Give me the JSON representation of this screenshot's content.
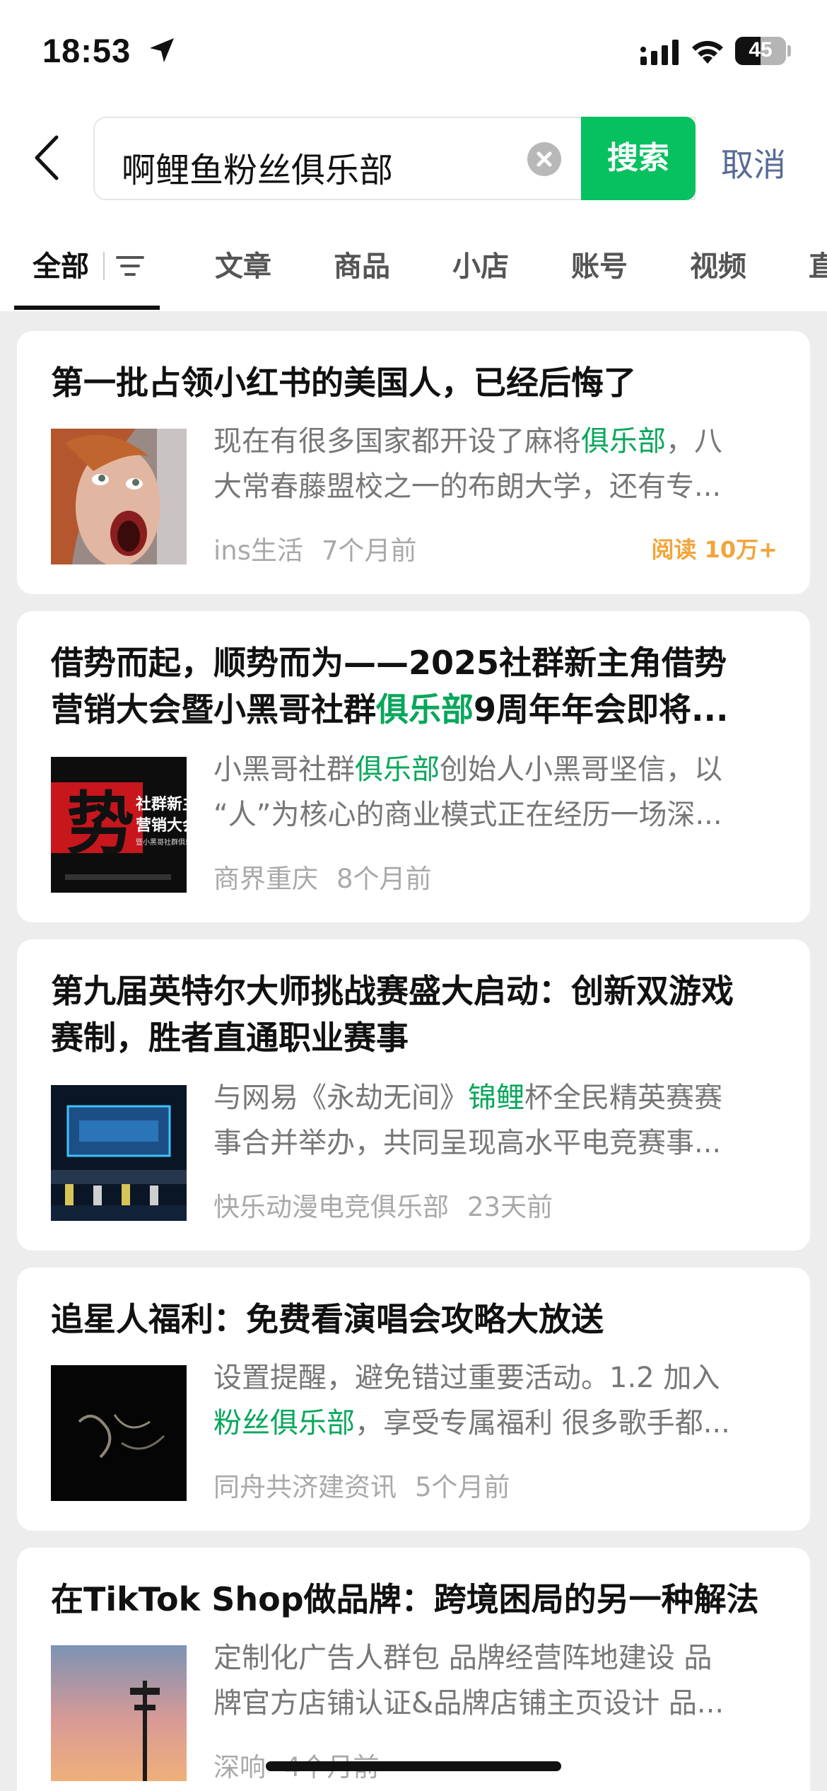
{
  "status_bar": {
    "time": "18:53",
    "battery": "45"
  },
  "search": {
    "query": "啊鲤鱼粉丝俱乐部",
    "button_label": "搜索",
    "cancel_label": "取消"
  },
  "tabs": [
    {
      "label": "全部",
      "active": true
    },
    {
      "label": "文章"
    },
    {
      "label": "商品"
    },
    {
      "label": "小店"
    },
    {
      "label": "账号"
    },
    {
      "label": "视频"
    },
    {
      "label": "直"
    }
  ],
  "results": [
    {
      "title": "第一批占领小红书的美国人，已经后悔了",
      "snippet_line1": [
        "现在有很多国家都开设了麻将",
        "俱乐部",
        "，八"
      ],
      "snippet_line2": "大常春藤盟校之一的布朗大学，还有专...",
      "source": "ins生活",
      "time": "7个月前",
      "reads": "阅读 10万+"
    },
    {
      "title_line1": "借势而起，顺势而为——2025社群新主角借势",
      "title_line2": [
        "营销大会暨小黑哥社群",
        "俱乐部",
        "9周年年会即将..."
      ],
      "snippet_line1": [
        "小黑哥社群",
        "俱乐部",
        "创始人小黑哥坚信，以"
      ],
      "snippet_line2": "“人”为核心的商业模式正在经历一场深...",
      "source": "商界重庆",
      "time": "8个月前",
      "thumb_text": [
        "势",
        "社群新主",
        "营销大会",
        "暨小黑哥社群俱乐"
      ]
    },
    {
      "title_line1": "第九届英特尔大师挑战赛盛大启动：创新双游戏",
      "title_line2": "赛制，胜者直通职业赛事",
      "snippet_line1": [
        "与网易《永劫无间》",
        "锦鲤",
        "杯全民精英赛赛"
      ],
      "snippet_line2": "事合并举办，共同呈现高水平电竞赛事...",
      "source": "快乐动漫电竞俱乐部",
      "time": "23天前"
    },
    {
      "title": "追星人福利：免费看演唱会攻略大放送",
      "snippet_line1": "设置提醒，避免错过重要活动。1.2 加入",
      "snippet_line2": [
        "粉丝俱乐部",
        "，享受专属福利 很多歌手都..."
      ],
      "source": "同舟共济建资讯",
      "time": "5个月前"
    },
    {
      "title": "在TikTok Shop做品牌：跨境困局的另一种解法",
      "snippet_line1": "定制化广告人群包 品牌经营阵地建设 品",
      "snippet_line2": "牌官方店铺认证&品牌店铺主页设计 品...",
      "source": "深响",
      "time": "4个月前"
    }
  ],
  "colors": {
    "accent_green": "#07c160",
    "highlight": "#07a75a",
    "link_blue": "#576b95",
    "reads_orange": "#f3a43b"
  }
}
